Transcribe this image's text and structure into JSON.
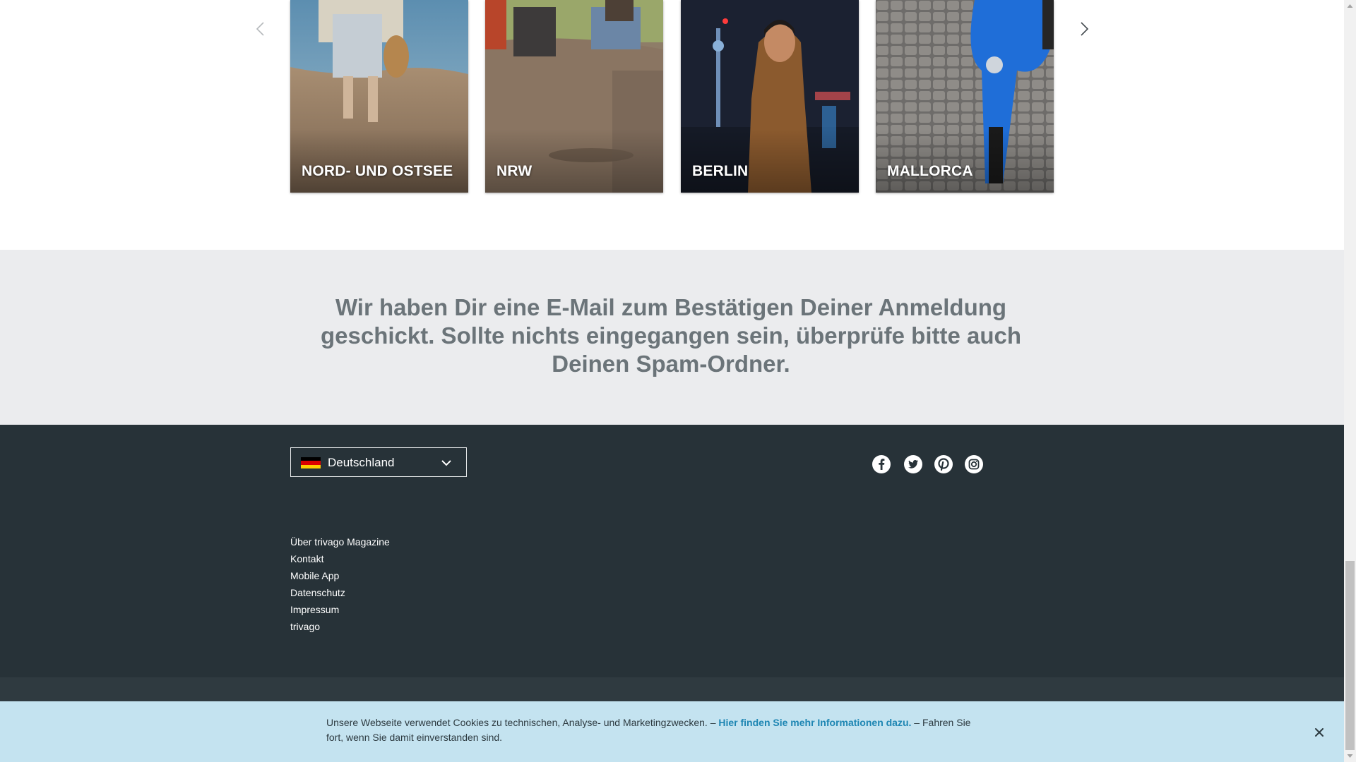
{
  "carousel": {
    "cards": [
      {
        "label": "NORD- UND OSTSEE"
      },
      {
        "label": "NRW"
      },
      {
        "label": "BERLIN"
      },
      {
        "label": "MALLORCA"
      }
    ],
    "prev_icon": "chevron-left-icon",
    "next_icon": "chevron-right-icon"
  },
  "confirmation": {
    "message": "Wir haben Dir eine E-Mail zum Bestätigen Deiner Anmeldung geschickt. Sollte nichts eingegangen sein, überprüfe bitte auch Deinen Spam-Ordner."
  },
  "footer": {
    "country_selector": {
      "value": "Deutschland",
      "flag": "germany-flag-icon"
    },
    "social_icons": [
      "facebook-icon",
      "twitter-icon",
      "pinterest-icon",
      "instagram-icon"
    ],
    "links": [
      "Über trivago Magazine",
      "Kontakt",
      "Mobile App",
      "Datenschutz",
      "Impressum",
      "trivago"
    ]
  },
  "cookie_banner": {
    "text_before": "Unsere Webseite verwendet Cookies zu technischen, Analyse- und Marketingzwecken. – ",
    "link_text": "Hier finden Sie mehr Informationen dazu.",
    "text_after": " – Fahren Sie fort, wenn Sie damit einverstanden sind.",
    "close_icon": "close-icon"
  },
  "colors": {
    "footer_bg": "#273238",
    "confirm_bg": "#ebecee",
    "cookie_bg": "#c4e3f0",
    "cookie_link": "#1e86b3",
    "confirm_text": "#6b7479"
  }
}
